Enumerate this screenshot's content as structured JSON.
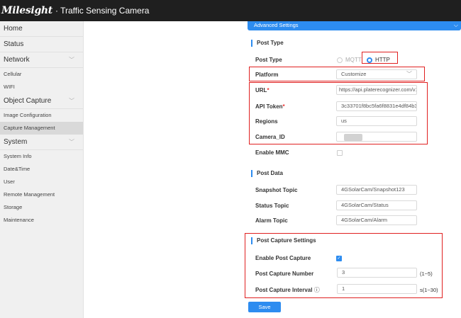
{
  "header": {
    "logo": "Milesight",
    "subtitle": "· Traffic Sensing Camera"
  },
  "sidebar": {
    "home": "Home",
    "status": "Status",
    "network": "Network",
    "cellular": "Cellular",
    "wifi": "WIFI",
    "object_capture": "Object Capture",
    "image_configuration": "Image Configuration",
    "capture_management": "Capture Management",
    "system": "System",
    "system_info": "System Info",
    "date_time": "Date&Time",
    "user": "User",
    "remote_management": "Remote Management",
    "storage": "Storage",
    "maintenance": "Maintenance"
  },
  "main": {
    "advanced_settings": "Advanced Settings",
    "post_type": {
      "section": "Post Type",
      "label": "Post Type",
      "option_mqtt": "MQTT",
      "option_http": "HTTP",
      "selected": "HTTP"
    },
    "platform": {
      "label": "Platform",
      "value": "Customize"
    },
    "url": {
      "label": "URL",
      "required": "*",
      "value": "https://api.platerecognizer.com/v1"
    },
    "api_token": {
      "label": "API Token",
      "required": "*",
      "value": "3c33701f8bc5fa6f8831e4df84b3"
    },
    "regions": {
      "label": "Regions",
      "value": "us"
    },
    "camera_id": {
      "label": "Camera_ID"
    },
    "enable_mmc": {
      "label": "Enable MMC",
      "checked": false
    },
    "post_data": {
      "section": "Post Data",
      "snapshot_label": "Snapshot Topic",
      "snapshot_value": "4GSolarCam/Snapshot123",
      "status_label": "Status Topic",
      "status_value": "4GSolarCam/Status",
      "alarm_label": "Alarm Topic",
      "alarm_value": "4GSolarCam/Alarm"
    },
    "post_capture": {
      "section": "Post Capture Settings",
      "enable_label": "Enable Post Capture",
      "enable_checked": true,
      "number_label": "Post Capture Number",
      "number_value": "3",
      "number_range": "(1~5)",
      "interval_label": "Post Capture Interval",
      "interval_info": "ⓘ",
      "interval_value": "1",
      "interval_range": "s(1~30)"
    },
    "save": "Save"
  },
  "colors": {
    "accent": "#2d8cf0",
    "highlight": "#e02020",
    "topbar": "#1f1f1f"
  }
}
